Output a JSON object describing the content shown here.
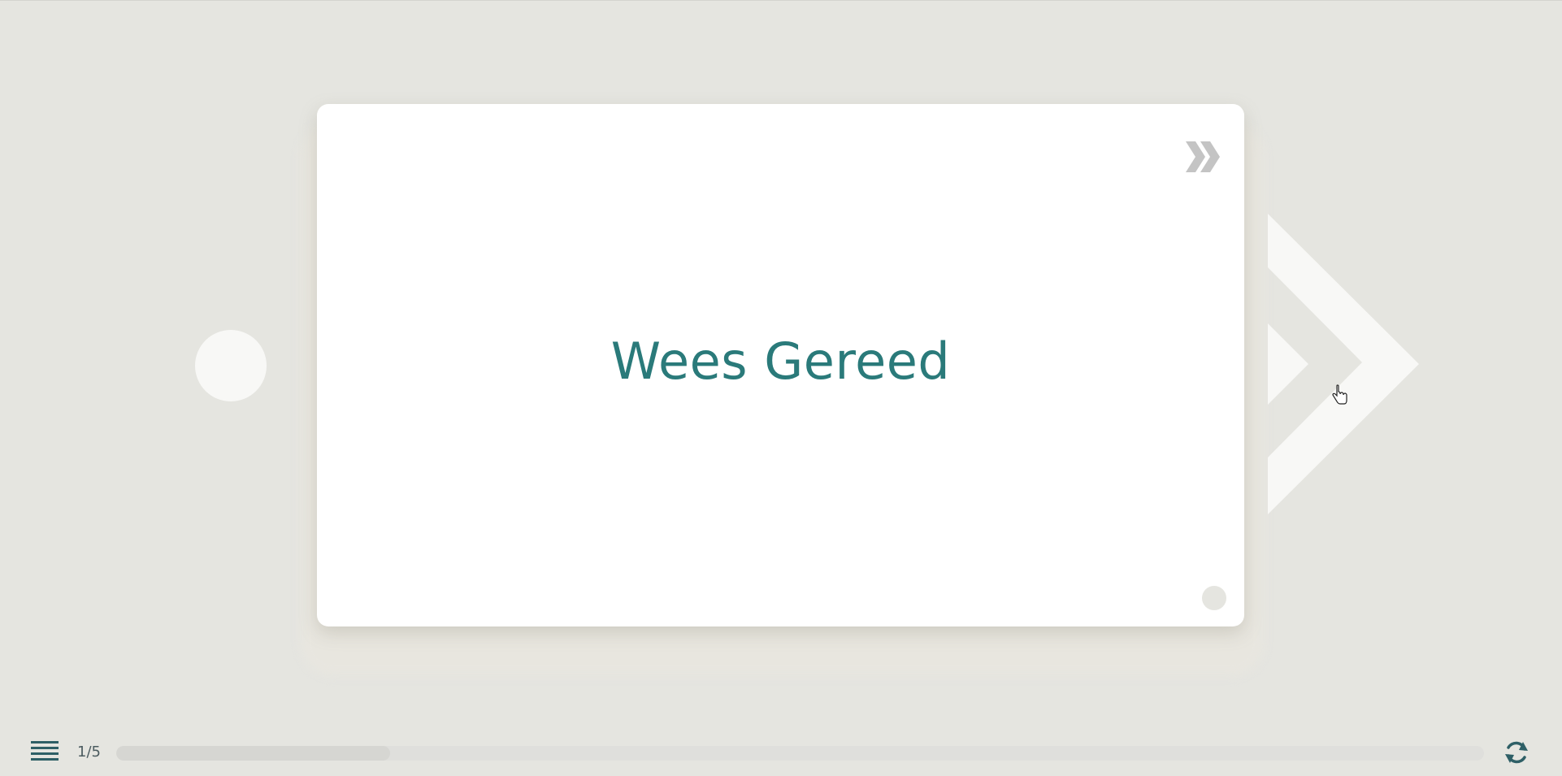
{
  "card": {
    "title": "Wees Gereed",
    "skip_icon": "double-chevron-right-icon",
    "corner_dot": "status-dot"
  },
  "navigation": {
    "previous_icon": "circle-button",
    "next_icon": "large-chevron-right-icon"
  },
  "footer": {
    "menu_icon": "hamburger-menu-icon",
    "page_counter": "1/5",
    "progress": 0.2,
    "restart_icon": "restart-icon"
  },
  "colors": {
    "background": "#e5e5e0",
    "card": "#ffffff",
    "accent": "#2a7a7a",
    "icon_dark": "#2e5f66",
    "skip_icon": "#c4c4c4",
    "nav_light": "#f8f8f6"
  }
}
